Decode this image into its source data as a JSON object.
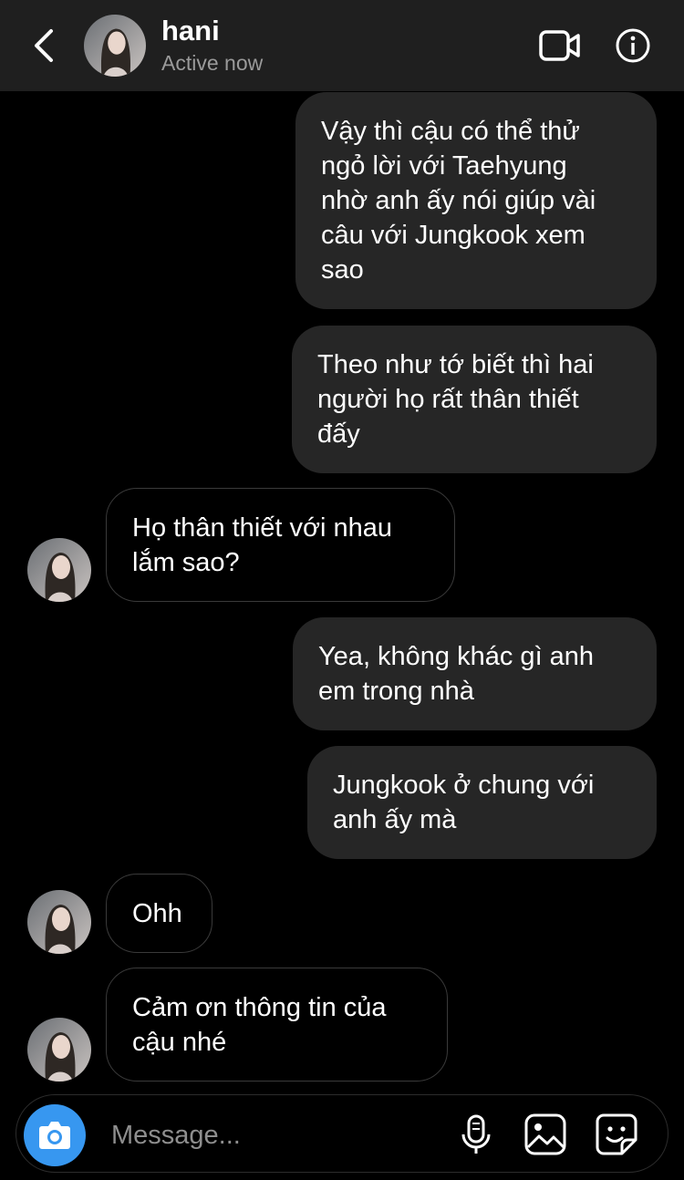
{
  "header": {
    "name": "hani",
    "status": "Active now",
    "icons": [
      "back-arrow-icon",
      "video-call-icon",
      "info-icon"
    ]
  },
  "messages": [
    {
      "from": "me",
      "lines": [
        "Vậy thì cậu có thể thử",
        "ngỏ lời với Taehyung",
        "nhờ anh ấy nói giúp vài",
        "câu với Jungkook xem",
        "sao"
      ]
    },
    {
      "from": "me",
      "lines": [
        "Theo như tớ biết thì hai",
        "người họ rất thân thiết",
        "đấy"
      ]
    },
    {
      "from": "hani",
      "lines": [
        "Họ thân thiết với nhau",
        "lắm sao?"
      ]
    },
    {
      "from": "me",
      "lines": [
        "Yea, không khác gì anh",
        "em trong nhà"
      ]
    },
    {
      "from": "me",
      "lines": [
        "Jungkook ở chung với",
        "anh ấy mà"
      ]
    },
    {
      "from": "hani",
      "lines": [
        "Ohh"
      ]
    },
    {
      "from": "hani",
      "lines": [
        "Cảm ơn thông tin của",
        "cậu nhé"
      ]
    }
  ],
  "composer": {
    "placeholder": "Message...",
    "icons": [
      "camera-icon",
      "microphone-icon",
      "gallery-icon",
      "sticker-icon"
    ]
  },
  "colors": {
    "header_bg": "#1f1f1f",
    "outgoing_bubble": "#262626",
    "camera_button": "#3797f0",
    "status_text": "#9a9a9a"
  }
}
